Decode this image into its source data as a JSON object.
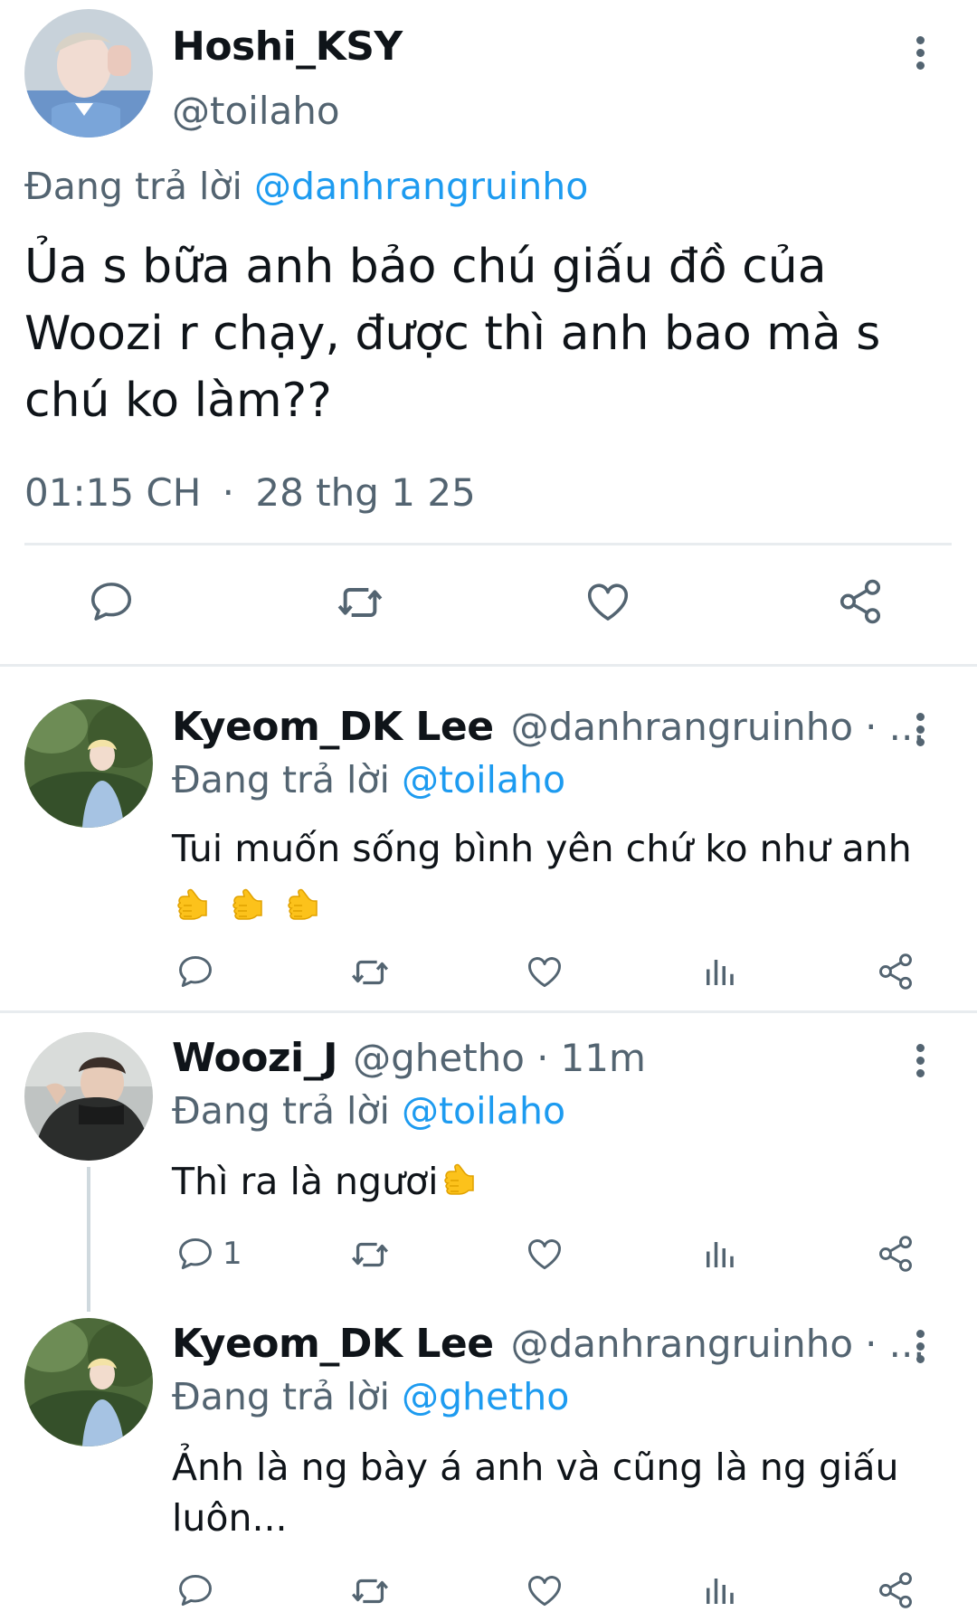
{
  "main_tweet": {
    "display_name": "Hoshi_KSY",
    "handle": "@toilaho",
    "replying_prefix": "Đang trả lời",
    "replying_to": "@danhrangruinho",
    "text_line1": "Ủa s bữa anh bảo chú giấu đồ của",
    "text_line2": "Woozi r chạy, được thì anh bao mà s",
    "text_line3": "chú ko làm??",
    "time": "01:15 CH",
    "separator": "·",
    "date": "28 thg 1 25"
  },
  "replies": [
    {
      "display_name": "Kyeom_DK Lee",
      "handle": "@danhrangruinho",
      "dot": "·",
      "ellipsis": "...",
      "replying_prefix": "Đang trả lời",
      "replying_to": "@toilaho",
      "text": "Tui muốn sống bình yên chứ ko như anh",
      "reply_count": ""
    },
    {
      "display_name": "Woozi_J",
      "handle": "@ghetho",
      "dot": "·",
      "time": "11m",
      "replying_prefix": "Đang trả lời",
      "replying_to": "@toilaho",
      "text": "Thì ra là ngươi",
      "reply_count": "1"
    },
    {
      "display_name": "Kyeom_DK Lee",
      "handle": "@danhrangruinho",
      "dot": "·",
      "ellipsis": "...",
      "replying_prefix": "Đang trả lời",
      "replying_to": "@ghetho",
      "text_line1": "Ảnh là ng bày á anh và cũng là ng giấu",
      "text_line2": "luôn..."
    }
  ],
  "icons": {
    "reply": "reply-icon",
    "retweet": "retweet-icon",
    "like": "heart-icon",
    "views": "views-icon",
    "share": "share-icon",
    "more": "more-vertical-icon",
    "emoji": "pointing-hand-emoji"
  },
  "colors": {
    "link": "#1d9bf0",
    "muted": "#536471",
    "text": "#0f1419",
    "divider": "#e8ecef"
  }
}
